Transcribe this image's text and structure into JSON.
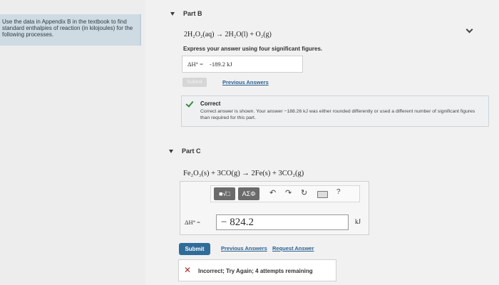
{
  "sidebar": {
    "instructions": "Use the data in Appendix B in the textbook to find standard enthalpies of reaction (in kilojoules) for the following processes."
  },
  "part_b": {
    "title": "Part B",
    "equation": "2H₂O₂(aq) → 2H₂O(l) + O₂(g)",
    "instruction": "Express your answer using four significant figures.",
    "answer_label": "ΔH° =",
    "answer_value": "-189.2 kJ",
    "submit_label": "Submit",
    "previous_answers_label": "Previous Answers",
    "feedback": {
      "title": "Correct",
      "message": "Correct answer is shown. Your answer −188.26 kJ was either rounded differently or used a different number of significant figures than required for this part."
    }
  },
  "part_c": {
    "title": "Part C",
    "equation": "Fe₂O₃(s) + 3CO(g) → 2Fe(s) + 3CO₂(g)",
    "toolbar": {
      "template_label": "■√□",
      "symbols_label": "ΑΣΦ",
      "undo_icon": "undo-icon",
      "redo_icon": "redo-icon",
      "reset_icon": "reset-icon",
      "keyboard_icon": "keyboard-icon",
      "help_label": "?"
    },
    "answer_label": "ΔH° =",
    "answer_value": "− 824.2",
    "unit": "kJ",
    "submit_label": "Submit",
    "previous_answers_label": "Previous Answers",
    "request_answer_label": "Request Answer",
    "feedback": "Incorrect; Try Again; 4 attempts remaining"
  },
  "colors": {
    "accent": "#2f6c9a",
    "correct": "#3c8a3a",
    "incorrect": "#b22b2b"
  }
}
